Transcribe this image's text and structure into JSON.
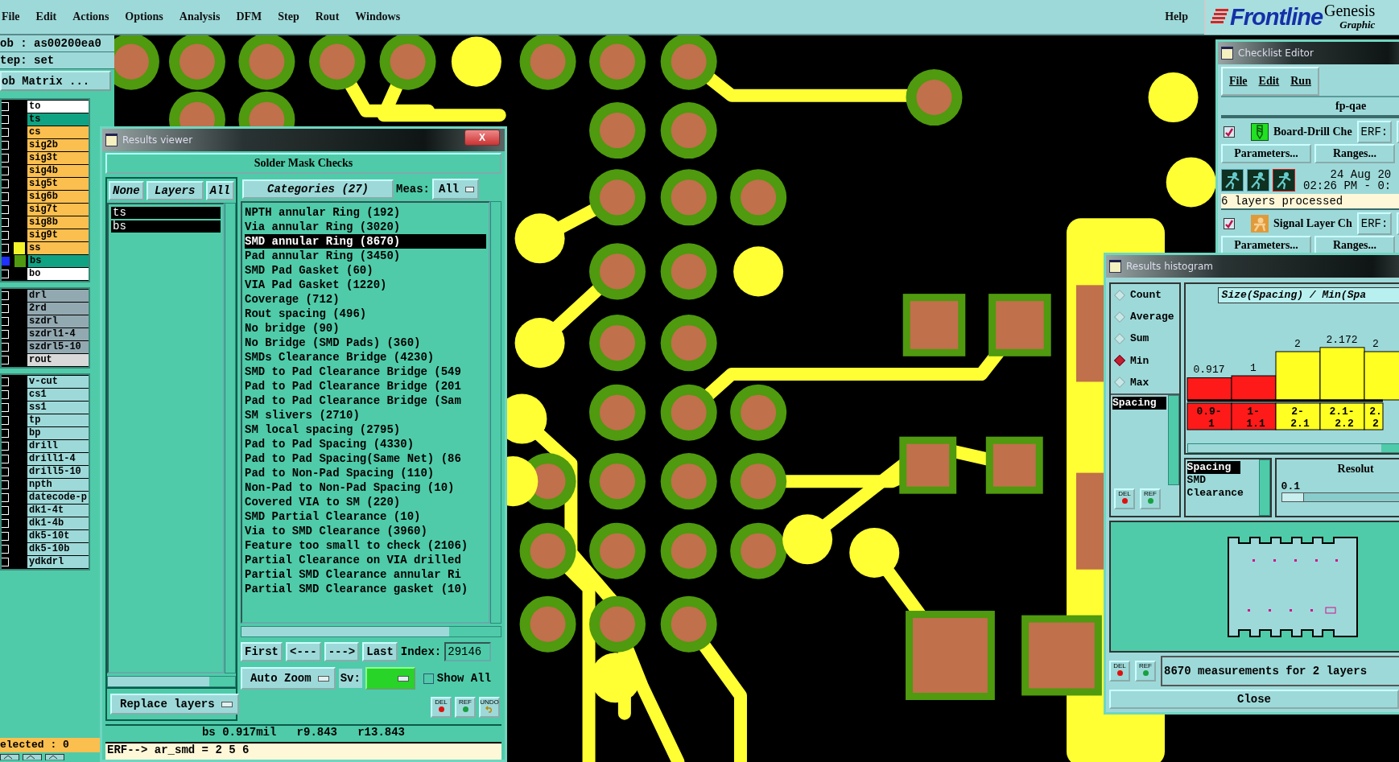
{
  "menu_bar": {
    "items": [
      "File",
      "Edit",
      "Actions",
      "Options",
      "Analysis",
      "DFM",
      "Step",
      "Rout",
      "Windows"
    ],
    "help": "Help"
  },
  "logo": {
    "brand": "Frontline",
    "product": "Genesis",
    "subtitle": "Graphic"
  },
  "job_panel": {
    "job": "ob : as00200ea0",
    "step": "tep: set",
    "matrix_button": "ob Matrix ...",
    "status": "elected : 0",
    "groups": [
      {
        "layers": [
          {
            "name": "to",
            "color": "#ffffff",
            "active": false
          },
          {
            "name": "ts",
            "color": "#10a383",
            "active": false
          },
          {
            "name": "cs",
            "color": "#fbbf4f",
            "active": false
          },
          {
            "name": "sig2b",
            "color": "#fbbf4f",
            "active": false
          },
          {
            "name": "sig3t",
            "color": "#fbbf4f",
            "active": false
          },
          {
            "name": "sig4b",
            "color": "#fbbf4f",
            "active": false
          },
          {
            "name": "sig5t",
            "color": "#fbbf4f",
            "active": false
          },
          {
            "name": "sig6b",
            "color": "#fbbf4f",
            "active": false
          },
          {
            "name": "sig7t",
            "color": "#fbbf4f",
            "active": false
          },
          {
            "name": "sig8b",
            "color": "#fbbf4f",
            "active": false
          },
          {
            "name": "sig9t",
            "color": "#fbbf4f",
            "active": false
          },
          {
            "name": "ss",
            "color": "#fbbf4f",
            "active": false,
            "display": {
              "color": "#f4f42a"
            }
          },
          {
            "name": "bs",
            "color": "#10a383",
            "active": true,
            "display": {
              "color": "#4f9a0e"
            }
          },
          {
            "name": "bo",
            "color": "#ffffff",
            "active": false
          }
        ]
      },
      {
        "layers": [
          {
            "name": "drl",
            "color": "#93a9b1",
            "active": false
          },
          {
            "name": "2rd",
            "color": "#93a9b1",
            "active": false
          },
          {
            "name": "szdrl",
            "color": "#93a9b1",
            "active": false
          },
          {
            "name": "szdrl1-4",
            "color": "#93a9b1",
            "active": false
          },
          {
            "name": "szdrl5-10",
            "color": "#93a9b1",
            "active": false
          },
          {
            "name": "rout",
            "color": "#d9d9d9",
            "active": false
          }
        ]
      },
      {
        "layers": [
          {
            "name": "v-cut",
            "color": "#9ed9d9",
            "active": false
          },
          {
            "name": "cs1",
            "color": "#9ed9d9",
            "active": false
          },
          {
            "name": "ss1",
            "color": "#9ed9d9",
            "active": false
          },
          {
            "name": "tp",
            "color": "#9ed9d9",
            "active": false
          },
          {
            "name": "bp",
            "color": "#9ed9d9",
            "active": false
          },
          {
            "name": "drill",
            "color": "#9ed9d9",
            "active": false
          },
          {
            "name": "drill1-4",
            "color": "#9ed9d9",
            "active": false
          },
          {
            "name": "drill5-10",
            "color": "#9ed9d9",
            "active": false
          },
          {
            "name": "npth",
            "color": "#9ed9d9",
            "active": false
          },
          {
            "name": "datecode-p",
            "color": "#9ed9d9",
            "active": false
          },
          {
            "name": "dk1-4t",
            "color": "#9ed9d9",
            "active": false
          },
          {
            "name": "dk1-4b",
            "color": "#9ed9d9",
            "active": false
          },
          {
            "name": "dk5-10t",
            "color": "#9ed9d9",
            "active": false
          },
          {
            "name": "dk5-10b",
            "color": "#9ed9d9",
            "active": false
          },
          {
            "name": "ydkdrl",
            "color": "#9ed9d9",
            "active": false
          }
        ]
      }
    ]
  },
  "results_viewer": {
    "title": "Results viewer",
    "close": "X",
    "heading": "Solder Mask Checks",
    "layer_buttons": [
      "None",
      "Layers",
      "All"
    ],
    "layers": [
      {
        "name": "ts",
        "selected": true
      },
      {
        "name": "bs",
        "selected": true
      }
    ],
    "replace_mode": "Replace layers",
    "categories_button": "Categories (27)",
    "meas_label": "Meas:",
    "meas_value": "All",
    "categories": [
      {
        "label": "NPTH annular Ring (192)",
        "selected": false
      },
      {
        "label": "Via annular Ring (3020)",
        "selected": false
      },
      {
        "label": "SMD annular Ring (8670)",
        "selected": true
      },
      {
        "label": "Pad annular Ring (3450)",
        "selected": false
      },
      {
        "label": "SMD Pad Gasket (60)",
        "selected": false
      },
      {
        "label": "VIA Pad Gasket (1220)",
        "selected": false
      },
      {
        "label": "Coverage (712)",
        "selected": false
      },
      {
        "label": "Rout spacing (496)",
        "selected": false
      },
      {
        "label": "No bridge (90)",
        "selected": false
      },
      {
        "label": "No Bridge (SMD Pads) (360)",
        "selected": false
      },
      {
        "label": "SMDs Clearance Bridge (4230)",
        "selected": false
      },
      {
        "label": "SMD to Pad Clearance Bridge (549",
        "selected": false
      },
      {
        "label": "Pad to Pad Clearance Bridge (201",
        "selected": false
      },
      {
        "label": "Pad to Pad Clearance Bridge (Sam",
        "selected": false
      },
      {
        "label": "SM slivers (2710)",
        "selected": false
      },
      {
        "label": "SM local spacing (2795)",
        "selected": false
      },
      {
        "label": "Pad to Pad Spacing (4330)",
        "selected": false
      },
      {
        "label": "Pad to Pad Spacing(Same Net) (86",
        "selected": false
      },
      {
        "label": "Pad to Non-Pad Spacing (110)",
        "selected": false
      },
      {
        "label": "Non-Pad to Non-Pad Spacing (10)",
        "selected": false
      },
      {
        "label": "Covered VIA to SM (220)",
        "selected": false
      },
      {
        "label": "SMD Partial Clearance (10)",
        "selected": false
      },
      {
        "label": "Via to SMD Clearance (3960)",
        "selected": false
      },
      {
        "label": "Feature too small to check (2106)",
        "selected": false
      },
      {
        "label": "Partial Clearance on VIA drilled",
        "selected": false
      },
      {
        "label": "Partial SMD Clearance annular Ri",
        "selected": false
      },
      {
        "label": "Partial SMD Clearance gasket (10)",
        "selected": false
      }
    ],
    "nav_buttons": [
      "First",
      "<---",
      "--->",
      "Last"
    ],
    "index_label": "Index:",
    "index_value": "29146",
    "zoom_mode": "Auto Zoom",
    "sv_label": "Sv:",
    "show_all": {
      "label": "Show All",
      "checked": false
    },
    "tools": [
      {
        "label": "DEL",
        "kind": "delete"
      },
      {
        "label": "REF",
        "kind": "refresh"
      },
      {
        "label": "UNDO",
        "kind": "undo"
      }
    ],
    "status": "bs 0.917mil   r9.843   r13.843",
    "erf_line": "ERF--> ar_smd = 2 5 6"
  },
  "checklist_editor": {
    "title": "Checklist Editor",
    "menu": [
      "File",
      "Edit",
      "Run"
    ],
    "name": "fp-qae",
    "checks": [
      {
        "title": "Board-Drill Che",
        "checked": true,
        "kind": "drill",
        "erf": "ERF:",
        "buttons": [
          "Parameters...",
          "Ranges..."
        ],
        "run_date": "24 Aug 20",
        "run_time": "02:26 PM - 0:",
        "message": "6 layers processed"
      },
      {
        "title": "Signal Layer Ch",
        "checked": true,
        "kind": "signal",
        "erf": "ERF:",
        "buttons": [
          "Parameters...",
          "Ranges..."
        ]
      }
    ]
  },
  "results_histogram": {
    "title": "Results histogram",
    "functions": [
      {
        "label": "Count",
        "selected": false
      },
      {
        "label": "Average",
        "selected": false
      },
      {
        "label": "Sum",
        "selected": false
      },
      {
        "label": "Min",
        "selected": true
      },
      {
        "label": "Max",
        "selected": false
      }
    ],
    "measures": [
      {
        "label": "Spacing",
        "selected": true
      }
    ],
    "chart_data": {
      "type": "bar",
      "title": "Size(Spacing) / Min(Spa",
      "categories": [
        "0.9-1",
        "1-1.1",
        "2-2.1",
        "2.1-2.2",
        "2.2"
      ],
      "values": [
        0.917,
        1,
        2,
        2.172,
        2
      ],
      "data_labels": true
    },
    "bins": [
      {
        "color": "#ff1a1a"
      },
      {
        "color": "#ff1a1a"
      },
      {
        "color": "#ffff22"
      },
      {
        "color": "#ffff22"
      },
      {
        "color": "#ffff22"
      }
    ],
    "attributes": [
      {
        "label": "Spacing",
        "selected": true
      },
      {
        "label": "SMD",
        "selected": false
      },
      {
        "label": "Clearance",
        "selected": false
      }
    ],
    "resolution_label": "Resolut",
    "resolution_value": "0.1",
    "resolution_slider": {
      "level": 0
    },
    "measure_tools": [
      {
        "label": "DEL",
        "kind": "delete"
      },
      {
        "label": "REF",
        "kind": "refresh"
      }
    ],
    "summary_tools": [
      {
        "label": "DEL",
        "kind": "delete"
      },
      {
        "label": "REF",
        "kind": "refresh"
      }
    ],
    "summary": "8670 measurements for 2 layers",
    "close": "Close"
  }
}
